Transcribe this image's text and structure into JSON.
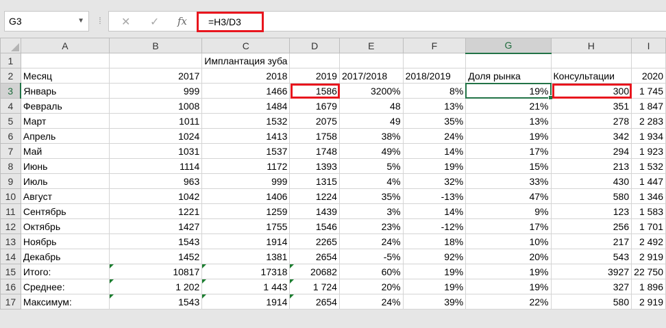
{
  "formula_bar": {
    "name_box": "G3",
    "formula": "=H3/D3",
    "icons": [
      "cancel-icon",
      "enter-icon",
      "function-icon"
    ]
  },
  "columns": [
    "A",
    "B",
    "C",
    "D",
    "E",
    "F",
    "G",
    "H",
    "I"
  ],
  "selected_column": "G",
  "selected_row": "3",
  "rows": [
    {
      "n": "1",
      "cells": [
        "",
        "",
        "Имплантация зуба",
        "",
        "",
        "",
        "",
        "",
        ""
      ]
    },
    {
      "n": "2",
      "cells": [
        "Месяц",
        "2017",
        "2018",
        "2019",
        "2017/2018",
        "2018/2019",
        "Доля рынка",
        "Консультации",
        "2020"
      ]
    },
    {
      "n": "3",
      "cells": [
        "Январь",
        "999",
        "1466",
        "1586",
        "3200%",
        "8%",
        "19%",
        "300",
        "1 745"
      ]
    },
    {
      "n": "4",
      "cells": [
        "Февраль",
        "1008",
        "1484",
        "1679",
        "48",
        "13%",
        "21%",
        "351",
        "1 847"
      ]
    },
    {
      "n": "5",
      "cells": [
        "Март",
        "1011",
        "1532",
        "2075",
        "49",
        "35%",
        "13%",
        "278",
        "2 283"
      ]
    },
    {
      "n": "6",
      "cells": [
        "Апрель",
        "1024",
        "1413",
        "1758",
        "38%",
        "24%",
        "19%",
        "342",
        "1 934"
      ]
    },
    {
      "n": "7",
      "cells": [
        "Май",
        "1031",
        "1537",
        "1748",
        "49%",
        "14%",
        "17%",
        "294",
        "1 923"
      ]
    },
    {
      "n": "8",
      "cells": [
        "Июнь",
        "1114",
        "1172",
        "1393",
        "5%",
        "19%",
        "15%",
        "213",
        "1 532"
      ]
    },
    {
      "n": "9",
      "cells": [
        "Июль",
        "963",
        "999",
        "1315",
        "4%",
        "32%",
        "33%",
        "430",
        "1 447"
      ]
    },
    {
      "n": "10",
      "cells": [
        "Август",
        "1042",
        "1406",
        "1224",
        "35%",
        "-13%",
        "47%",
        "580",
        "1 346"
      ]
    },
    {
      "n": "11",
      "cells": [
        "Сентябрь",
        "1221",
        "1259",
        "1439",
        "3%",
        "14%",
        "9%",
        "123",
        "1 583"
      ]
    },
    {
      "n": "12",
      "cells": [
        "Октябрь",
        "1427",
        "1755",
        "1546",
        "23%",
        "-12%",
        "17%",
        "256",
        "1 701"
      ]
    },
    {
      "n": "13",
      "cells": [
        "Ноябрь",
        "1543",
        "1914",
        "2265",
        "24%",
        "18%",
        "10%",
        "217",
        "2 492"
      ]
    },
    {
      "n": "14",
      "cells": [
        "Декабрь",
        "1452",
        "1381",
        "2654",
        "-5%",
        "92%",
        "20%",
        "543",
        "2 919"
      ]
    },
    {
      "n": "15",
      "cells": [
        "Итого:",
        "10817",
        "17318",
        "20682",
        "60%",
        "19%",
        "19%",
        "3927",
        "22 750"
      ]
    },
    {
      "n": "16",
      "cells": [
        "Среднее:",
        "1 202",
        "1 443",
        "1 724",
        "20%",
        "19%",
        "19%",
        "327",
        "1 896"
      ]
    },
    {
      "n": "17",
      "cells": [
        "Максимум:",
        "1543",
        "1914",
        "2654",
        "24%",
        "39%",
        "22%",
        "580",
        "2 919"
      ]
    }
  ],
  "colors": {
    "highlight_red": "#e8151d",
    "active_green": "#217346",
    "error_triangle": "#1b7d2f"
  }
}
